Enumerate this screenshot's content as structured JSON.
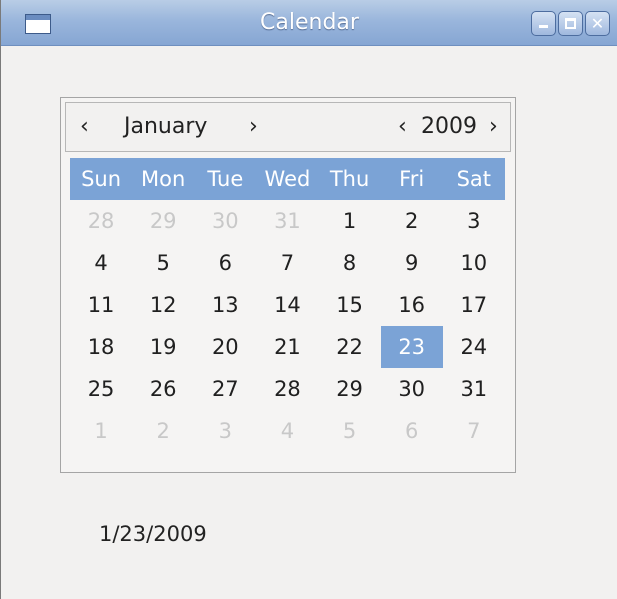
{
  "window": {
    "title": "Calendar",
    "buttons": {
      "minimize": "minimize",
      "maximize": "maximize",
      "close": "✕"
    }
  },
  "calendar": {
    "month_prev": "‹",
    "month": "January",
    "month_next": "›",
    "year_prev": "‹",
    "year": "2009",
    "year_next": "›",
    "weekdays": [
      "Sun",
      "Mon",
      "Tue",
      "Wed",
      "Thu",
      "Fri",
      "Sat"
    ],
    "weeks": [
      [
        {
          "d": "28",
          "other": true
        },
        {
          "d": "29",
          "other": true
        },
        {
          "d": "30",
          "other": true
        },
        {
          "d": "31",
          "other": true
        },
        {
          "d": "1"
        },
        {
          "d": "2"
        },
        {
          "d": "3"
        }
      ],
      [
        {
          "d": "4"
        },
        {
          "d": "5"
        },
        {
          "d": "6"
        },
        {
          "d": "7"
        },
        {
          "d": "8"
        },
        {
          "d": "9"
        },
        {
          "d": "10"
        }
      ],
      [
        {
          "d": "11"
        },
        {
          "d": "12"
        },
        {
          "d": "13"
        },
        {
          "d": "14"
        },
        {
          "d": "15"
        },
        {
          "d": "16"
        },
        {
          "d": "17"
        }
      ],
      [
        {
          "d": "18"
        },
        {
          "d": "19"
        },
        {
          "d": "20"
        },
        {
          "d": "21"
        },
        {
          "d": "22"
        },
        {
          "d": "23",
          "selected": true
        },
        {
          "d": "24"
        }
      ],
      [
        {
          "d": "25"
        },
        {
          "d": "26"
        },
        {
          "d": "27"
        },
        {
          "d": "28"
        },
        {
          "d": "29"
        },
        {
          "d": "30"
        },
        {
          "d": "31"
        }
      ],
      [
        {
          "d": "1",
          "other": true
        },
        {
          "d": "2",
          "other": true
        },
        {
          "d": "3",
          "other": true
        },
        {
          "d": "4",
          "other": true
        },
        {
          "d": "5",
          "other": true
        },
        {
          "d": "6",
          "other": true
        },
        {
          "d": "7",
          "other": true
        }
      ]
    ],
    "selection_color": "#7ba3d6"
  },
  "selected_date_text": "1/23/2009"
}
